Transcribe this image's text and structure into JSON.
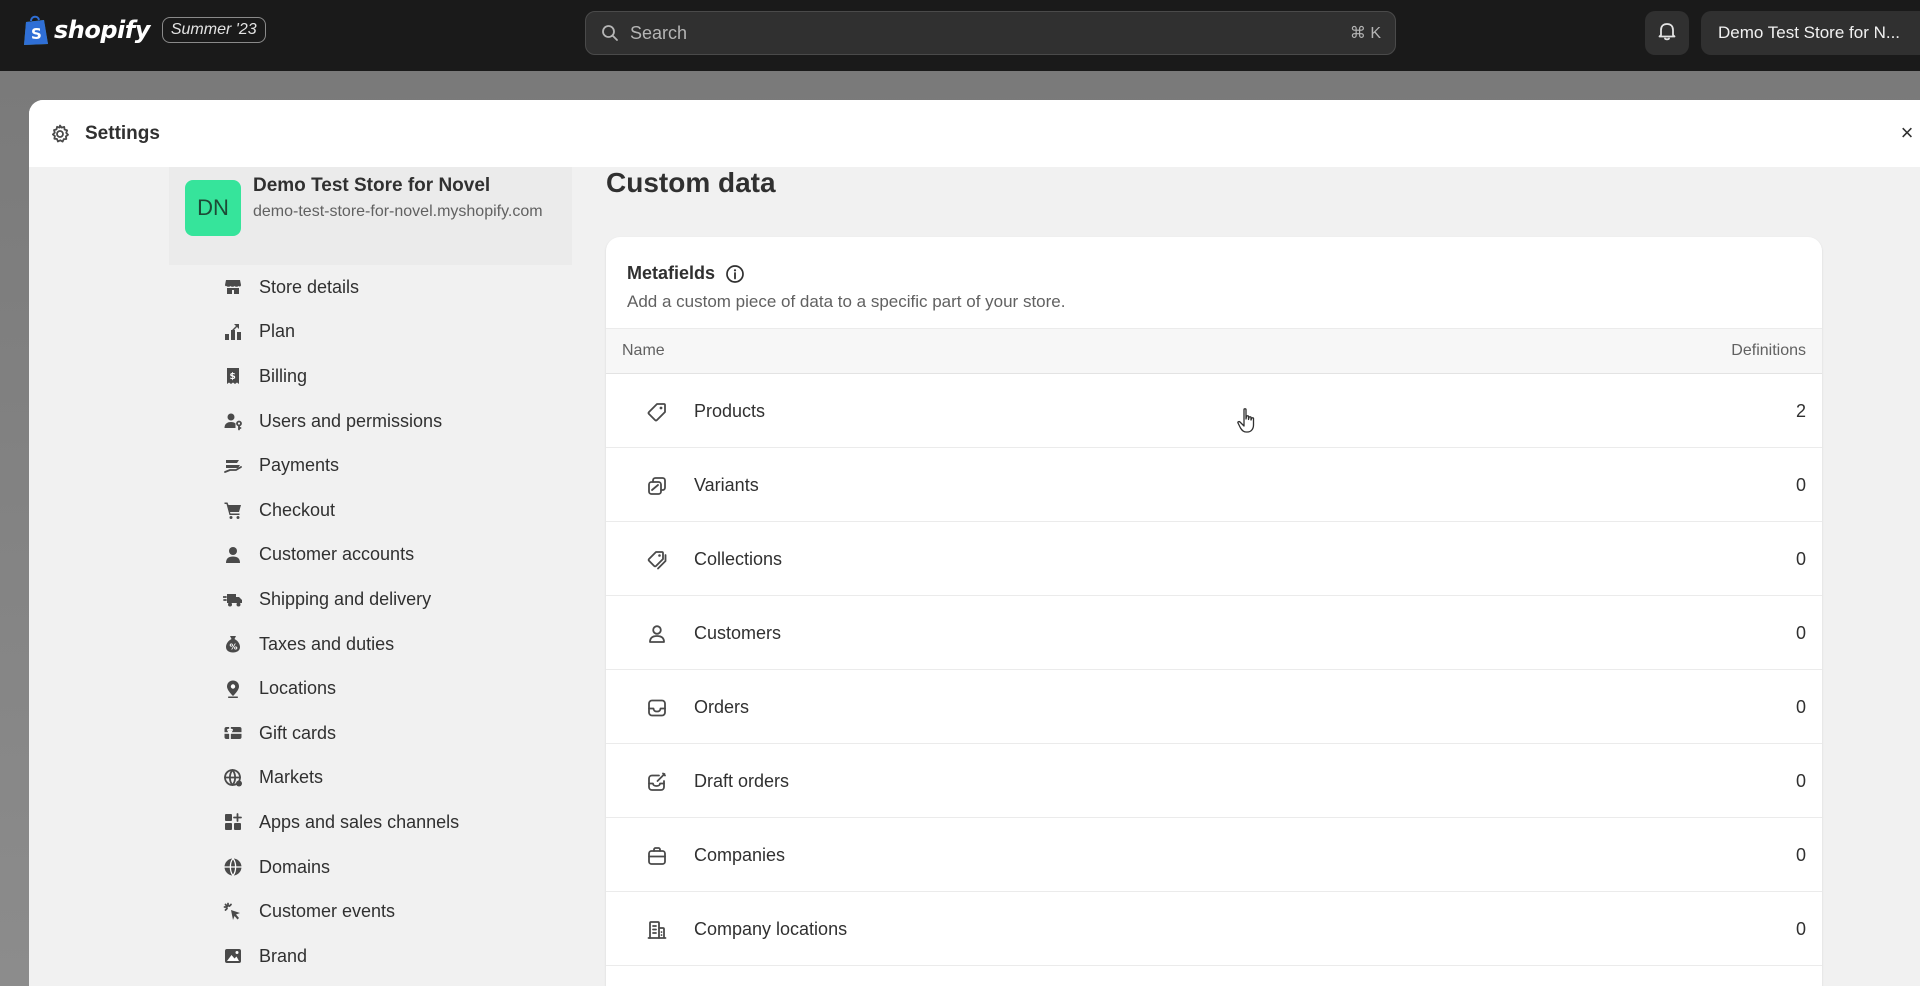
{
  "topbar": {
    "logo_text": "shopify",
    "edition_badge": "Summer '23",
    "search": {
      "placeholder": "Search",
      "shortcut": "⌘ K"
    },
    "store_switcher": "Demo Test Store for N..."
  },
  "modal": {
    "title": "Settings",
    "close_glyph": "×"
  },
  "store": {
    "initials": "DN",
    "name": "Demo Test Store for Novel",
    "url": "demo-test-store-for-novel.myshopify.com"
  },
  "sidebar": {
    "items": [
      {
        "label": "Store details",
        "icon": "store-icon"
      },
      {
        "label": "Plan",
        "icon": "plan-icon"
      },
      {
        "label": "Billing",
        "icon": "billing-icon"
      },
      {
        "label": "Users and permissions",
        "icon": "users-icon"
      },
      {
        "label": "Payments",
        "icon": "payments-icon"
      },
      {
        "label": "Checkout",
        "icon": "cart-icon"
      },
      {
        "label": "Customer accounts",
        "icon": "person-icon"
      },
      {
        "label": "Shipping and delivery",
        "icon": "truck-icon"
      },
      {
        "label": "Taxes and duties",
        "icon": "tax-icon"
      },
      {
        "label": "Locations",
        "icon": "location-pin-icon"
      },
      {
        "label": "Gift cards",
        "icon": "gift-card-icon"
      },
      {
        "label": "Markets",
        "icon": "globe-icon"
      },
      {
        "label": "Apps and sales channels",
        "icon": "apps-icon"
      },
      {
        "label": "Domains",
        "icon": "domains-icon"
      },
      {
        "label": "Customer events",
        "icon": "cursor-click-icon"
      },
      {
        "label": "Brand",
        "icon": "brand-icon"
      }
    ]
  },
  "main": {
    "title": "Custom data",
    "metafields": {
      "title": "Metafields",
      "subtitle": "Add a custom piece of data to a specific part of your store.",
      "columns": {
        "name": "Name",
        "definitions": "Definitions"
      },
      "rows": [
        {
          "label": "Products",
          "count": "2",
          "icon": "tag-icon"
        },
        {
          "label": "Variants",
          "count": "0",
          "icon": "variants-icon"
        },
        {
          "label": "Collections",
          "count": "0",
          "icon": "collection-icon"
        },
        {
          "label": "Customers",
          "count": "0",
          "icon": "person-icon"
        },
        {
          "label": "Orders",
          "count": "0",
          "icon": "inbox-icon"
        },
        {
          "label": "Draft orders",
          "count": "0",
          "icon": "draft-order-icon"
        },
        {
          "label": "Companies",
          "count": "0",
          "icon": "briefcase-icon"
        },
        {
          "label": "Company locations",
          "count": "0",
          "icon": "building-icon"
        }
      ]
    }
  },
  "colors": {
    "topbar_bg": "#1a1a1a",
    "avatar_bg": "#36e49b",
    "page_bg": "#f1f1f1"
  }
}
